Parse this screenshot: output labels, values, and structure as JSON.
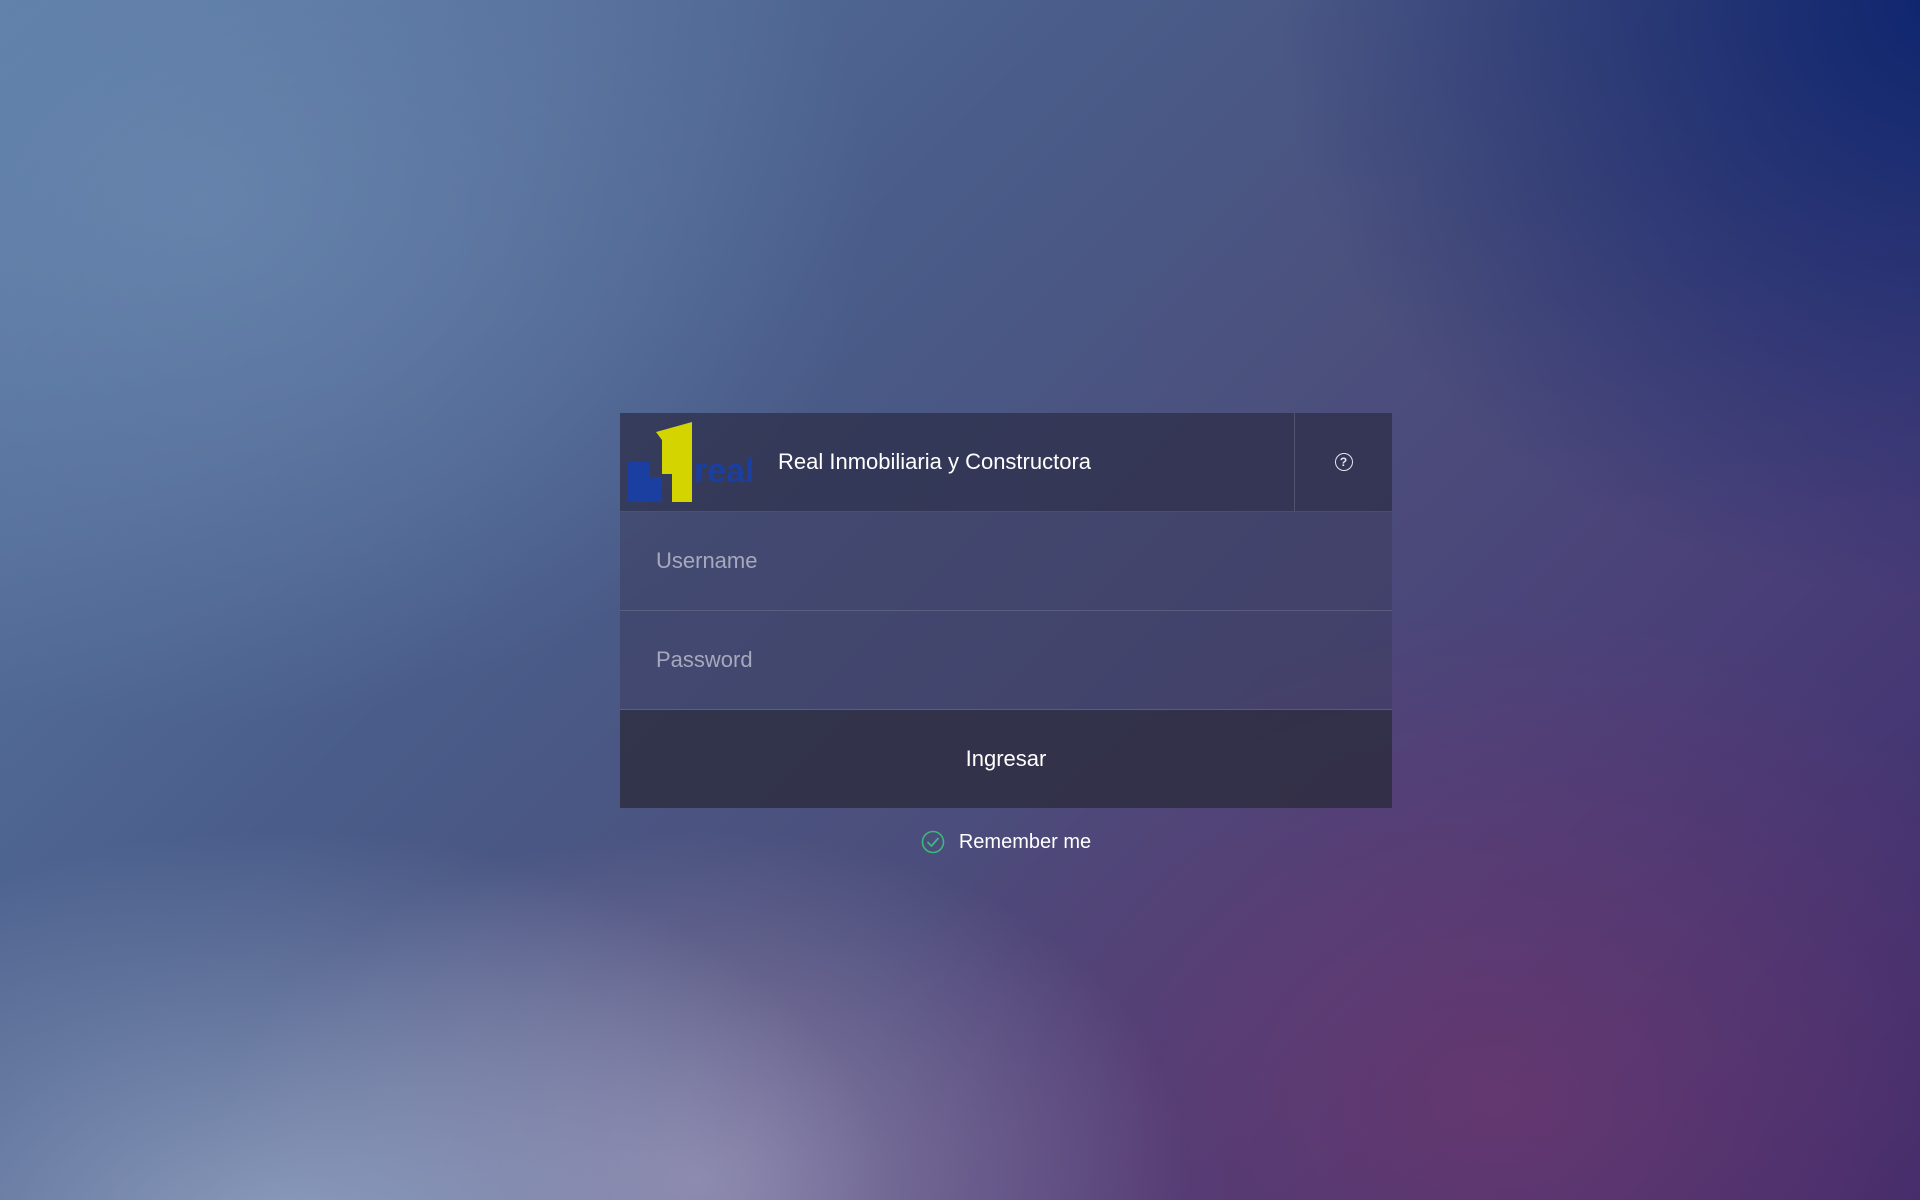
{
  "header": {
    "company_name": "Real Inmobiliaria y Constructora",
    "logo_text": "real",
    "help_icon": "question-circle-icon"
  },
  "form": {
    "username_placeholder": "Username",
    "password_placeholder": "Password",
    "submit_label": "Ingresar",
    "remember_label": "Remember me",
    "remember_checked": true
  },
  "colors": {
    "logo_yellow": "#d4d400",
    "logo_blue": "#1a3fa0",
    "check_green": "#3cb878"
  }
}
